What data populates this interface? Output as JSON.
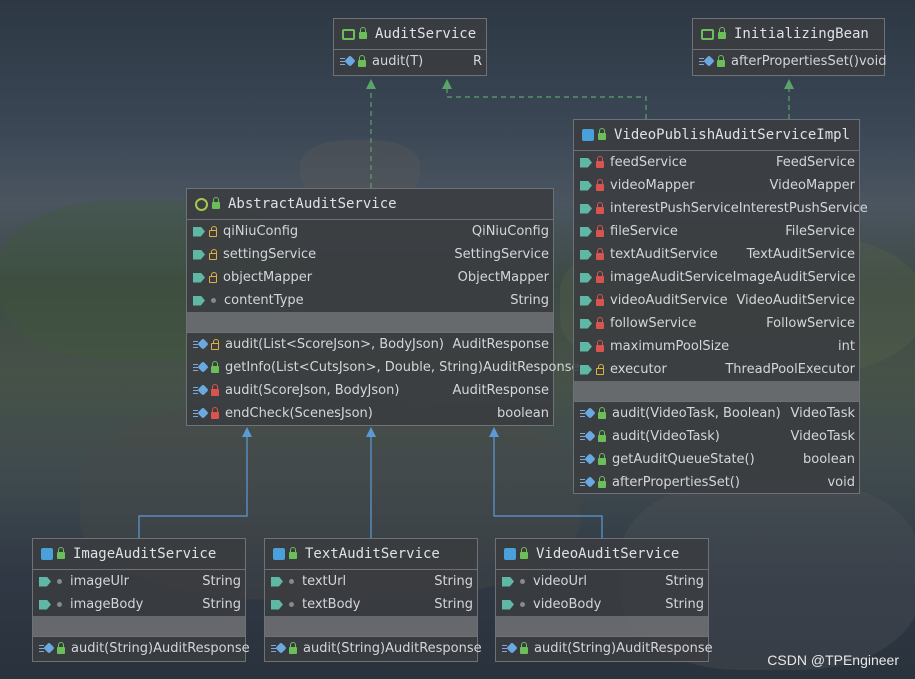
{
  "watermark": "CSDN @TPEngineer",
  "colors": {
    "background": "#3a4654",
    "box": "#3a3c40",
    "implements_edge": "#5aa469",
    "extends_edge": "#5b9bd5"
  },
  "nodes": {
    "audit_service": {
      "title": "AuditService",
      "methods": [
        {
          "name": "audit(T)",
          "type": "R"
        }
      ]
    },
    "initializing_bean": {
      "title": "InitializingBean",
      "methods": [
        {
          "name": "afterPropertiesSet()",
          "type": "void"
        }
      ]
    },
    "abstract_audit_service": {
      "title": "AbstractAuditService",
      "fields": [
        {
          "name": "qiNiuConfig",
          "type": "QiNiuConfig"
        },
        {
          "name": "settingService",
          "type": "SettingService"
        },
        {
          "name": "objectMapper",
          "type": "ObjectMapper"
        },
        {
          "name": "contentType",
          "type": "String"
        }
      ],
      "methods": [
        {
          "name": "audit(List<ScoreJson>, BodyJson)",
          "type": "AuditResponse"
        },
        {
          "name": "getInfo(List<CutsJson>, Double, String)",
          "type": "AuditResponse"
        },
        {
          "name": "audit(ScoreJson, BodyJson)",
          "type": "AuditResponse"
        },
        {
          "name": "endCheck(ScenesJson)",
          "type": "boolean"
        }
      ]
    },
    "video_publish_audit_service_impl": {
      "title": "VideoPublishAuditServiceImpl",
      "fields": [
        {
          "name": "feedService",
          "type": "FeedService"
        },
        {
          "name": "videoMapper",
          "type": "VideoMapper"
        },
        {
          "name": "interestPushService",
          "type": "InterestPushService"
        },
        {
          "name": "fileService",
          "type": "FileService"
        },
        {
          "name": "textAuditService",
          "type": "TextAuditService"
        },
        {
          "name": "imageAuditService",
          "type": "ImageAuditService"
        },
        {
          "name": "videoAuditService",
          "type": "VideoAuditService"
        },
        {
          "name": "followService",
          "type": "FollowService"
        },
        {
          "name": "maximumPoolSize",
          "type": "int"
        },
        {
          "name": "executor",
          "type": "ThreadPoolExecutor"
        }
      ],
      "methods": [
        {
          "name": "audit(VideoTask, Boolean)",
          "type": "VideoTask"
        },
        {
          "name": "audit(VideoTask)",
          "type": "VideoTask"
        },
        {
          "name": "getAuditQueueState()",
          "type": "boolean"
        },
        {
          "name": "afterPropertiesSet()",
          "type": "void"
        }
      ]
    },
    "image_audit_service": {
      "title": "ImageAuditService",
      "fields": [
        {
          "name": "imageUlr",
          "type": "String"
        },
        {
          "name": "imageBody",
          "type": "String"
        }
      ],
      "methods": [
        {
          "name": "audit(String)",
          "type": "AuditResponse"
        }
      ]
    },
    "text_audit_service": {
      "title": "TextAuditService",
      "fields": [
        {
          "name": "textUrl",
          "type": "String"
        },
        {
          "name": "textBody",
          "type": "String"
        }
      ],
      "methods": [
        {
          "name": "audit(String)",
          "type": "AuditResponse"
        }
      ]
    },
    "video_audit_service": {
      "title": "VideoAuditService",
      "fields": [
        {
          "name": "videoUrl",
          "type": "String"
        },
        {
          "name": "videoBody",
          "type": "String"
        }
      ],
      "methods": [
        {
          "name": "audit(String)",
          "type": "AuditResponse"
        }
      ]
    }
  }
}
